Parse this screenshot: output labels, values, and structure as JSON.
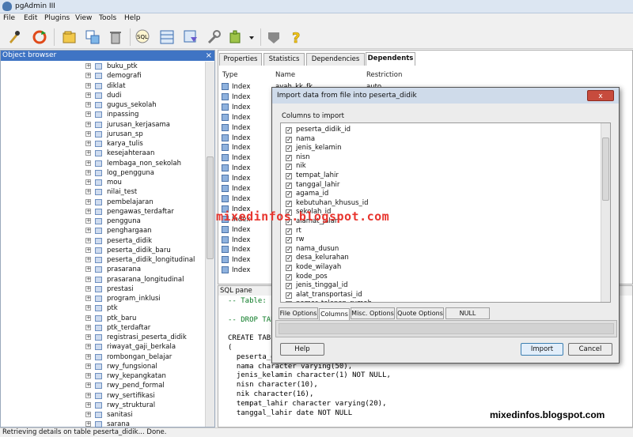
{
  "window": {
    "title": "pgAdmin III"
  },
  "menu": [
    "File",
    "Edit",
    "Plugins",
    "View",
    "Tools",
    "Help"
  ],
  "toolbar": {
    "icons": [
      "connect-icon",
      "refresh-icon",
      "properties-icon",
      "create-object-icon",
      "drop-icon",
      "sql-icon",
      "view-data-icon",
      "filtered-data-icon",
      "maintenance-icon",
      "plugins-icon",
      "dropdown-icon",
      "hint-icon",
      "help-icon"
    ],
    "sql_label": "SQL"
  },
  "object_browser": {
    "title": "Object browser",
    "close": "×",
    "items": [
      "buku_ptk",
      "demografi",
      "diklat",
      "dudi",
      "gugus_sekolah",
      "inpassing",
      "jurusan_kerjasama",
      "jurusan_sp",
      "karya_tulis",
      "kesejahteraan",
      "lembaga_non_sekolah",
      "log_pengguna",
      "mou",
      "nilai_test",
      "pembelajaran",
      "pengawas_terdaftar",
      "pengguna",
      "penghargaan",
      "peserta_didik",
      "peserta_didik_baru",
      "peserta_didik_longitudinal",
      "prasarana",
      "prasarana_longitudinal",
      "prestasi",
      "program_inklusi",
      "ptk",
      "ptk_baru",
      "ptk_terdaftar",
      "registrasi_peserta_didik",
      "riwayat_gaji_berkala",
      "rombongan_belajar",
      "rwy_fungsional",
      "rwy_kepangkatan",
      "rwy_pend_formal",
      "rwy_sertifikasi",
      "rwy_struktural",
      "sanitasi",
      "sarana"
    ],
    "selected": "peserta_didik",
    "expander": "+"
  },
  "tabs": [
    {
      "label": "Properties"
    },
    {
      "label": "Statistics"
    },
    {
      "label": "Dependencies"
    },
    {
      "label": "Dependents"
    }
  ],
  "dependents": {
    "headers": [
      "Type",
      "Name",
      "Restriction"
    ],
    "first_name": "ayah_kk_fk",
    "first_restriction": "auto",
    "rows": [
      "Index",
      "Index",
      "Index",
      "Index",
      "Index",
      "Index",
      "Index",
      "Index",
      "Index",
      "Index",
      "Index",
      "Index",
      "Index",
      "Index",
      "Index",
      "Index",
      "Index",
      "Index",
      "Index"
    ]
  },
  "sql_pane": {
    "title": "SQL pane",
    "lines": [
      "-- Table: p",
      "",
      "-- DROP TAB",
      "",
      "CREATE TABL",
      "(",
      "  peserta_d",
      "  nama character varying(50),",
      "  jenis_kelamin character(1) NOT NULL,",
      "  nisn character(10),",
      "  nik character(16),",
      "  tempat_lahir character varying(20),",
      "  tanggal_lahir date NOT NULL"
    ]
  },
  "dialog": {
    "title": "Import data from file into peserta_didik",
    "close": "x",
    "columns_label": "Columns to import",
    "check": "✓",
    "columns": [
      "peserta_didik_id",
      "nama",
      "jenis_kelamin",
      "nisn",
      "nik",
      "tempat_lahir",
      "tanggal_lahir",
      "agama_id",
      "kebutuhan_khusus_id",
      "sekolah_id",
      "alamat_jalan",
      "rt",
      "rw",
      "nama_dusun",
      "desa_kelurahan",
      "kode_wilayah",
      "kode_pos",
      "jenis_tinggal_id",
      "alat_transportasi_id",
      "nomor_telepon_rumah"
    ],
    "tabs": [
      "File Options",
      "Columns",
      "Misc. Options",
      "Quote Options",
      "NULL Options"
    ],
    "active_tab": "Columns",
    "help": "Help",
    "import": "Import",
    "cancel": "Cancel"
  },
  "watermark": "mixedinfos.blogspot.com",
  "corner_watermark": "mixedinfos.blogspot.com",
  "status": "Retrieving details on table peserta_didik... Done."
}
